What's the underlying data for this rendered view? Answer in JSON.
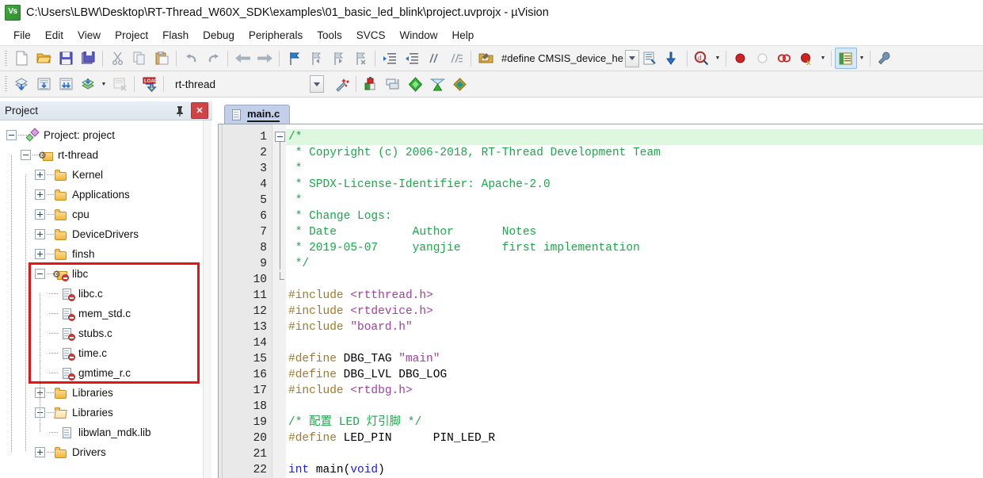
{
  "window": {
    "title": "C:\\Users\\LBW\\Desktop\\RT-Thread_W60X_SDK\\examples\\01_basic_led_blink\\project.uvprojx - µVision",
    "app_icon": "uvision-icon"
  },
  "menubar": {
    "items": [
      "File",
      "Edit",
      "View",
      "Project",
      "Flash",
      "Debug",
      "Peripherals",
      "Tools",
      "SVCS",
      "Window",
      "Help"
    ]
  },
  "toolbar_main": {
    "buttons": [
      {
        "name": "new-file-icon",
        "glyph": "new"
      },
      {
        "name": "open-file-icon",
        "glyph": "open"
      },
      {
        "name": "save-icon",
        "glyph": "save"
      },
      {
        "name": "save-all-icon",
        "glyph": "saveall"
      },
      {
        "name": "cut-icon",
        "glyph": "cut"
      },
      {
        "name": "copy-icon",
        "glyph": "copy"
      },
      {
        "name": "paste-icon",
        "glyph": "paste"
      },
      {
        "name": "undo-icon",
        "glyph": "undo"
      },
      {
        "name": "redo-icon",
        "glyph": "redo"
      },
      {
        "name": "navigate-back-icon",
        "glyph": "back"
      },
      {
        "name": "navigate-forward-icon",
        "glyph": "forward"
      },
      {
        "name": "bookmark-toggle-icon",
        "glyph": "bmk"
      },
      {
        "name": "bookmark-prev-icon",
        "glyph": "bmkprev"
      },
      {
        "name": "bookmark-next-icon",
        "glyph": "bmknext"
      },
      {
        "name": "bookmark-clear-icon",
        "glyph": "bmkclear"
      },
      {
        "name": "indent-icon",
        "glyph": "indent"
      },
      {
        "name": "outdent-icon",
        "glyph": "outdent"
      },
      {
        "name": "comment-icon",
        "glyph": "comment"
      },
      {
        "name": "uncomment-icon",
        "glyph": "uncomment"
      }
    ],
    "define_combo_value": "#define CMSIS_device_he",
    "right_buttons": [
      {
        "name": "configure-target-icon",
        "glyph": "cfgtarget"
      },
      {
        "name": "text-browse-icon",
        "glyph": "browse"
      },
      {
        "name": "insert-code-icon",
        "glyph": "inscode"
      },
      {
        "name": "find-in-files-icon",
        "glyph": "find"
      },
      {
        "name": "breakpoint-icon",
        "glyph": "bp"
      },
      {
        "name": "breakpoint-disable-icon",
        "glyph": "bpoff"
      },
      {
        "name": "kill-breakpoints-icon",
        "glyph": "bpkill"
      },
      {
        "name": "disable-all-breakpoints-icon",
        "glyph": "bpdisall"
      },
      {
        "name": "manage-windows-icon",
        "glyph": "winmgr"
      },
      {
        "name": "configure-icon",
        "glyph": "wrench"
      }
    ]
  },
  "toolbar_build": {
    "buttons": [
      {
        "name": "translate-icon",
        "glyph": "translate"
      },
      {
        "name": "build-icon",
        "glyph": "build"
      },
      {
        "name": "rebuild-icon",
        "glyph": "rebuild"
      },
      {
        "name": "batch-build-icon",
        "glyph": "batch"
      },
      {
        "name": "stop-build-icon",
        "glyph": "stopbuild"
      },
      {
        "name": "download-icon",
        "glyph": "download"
      }
    ],
    "target_value": "rt-thread",
    "right_buttons": [
      {
        "name": "target-options-icon",
        "glyph": "magicwand"
      },
      {
        "name": "manage-project-items-icon",
        "glyph": "projitems"
      },
      {
        "name": "manage-run-time-environment-icon",
        "glyph": "rte"
      },
      {
        "name": "select-software-packs-icon",
        "glyph": "packs"
      },
      {
        "name": "pack-installer-icon",
        "glyph": "packinst"
      },
      {
        "name": "multi-project-icon",
        "glyph": "multiproj"
      }
    ]
  },
  "project_panel": {
    "title": "Project",
    "pin_icon": "pin-icon",
    "close_icon": "close-icon",
    "tree": [
      {
        "label": "Project: project",
        "depth": 0,
        "icon": "proj",
        "state": "expanded",
        "marked": false
      },
      {
        "label": "rt-thread",
        "depth": 1,
        "icon": "group",
        "state": "expanded",
        "marked": false
      },
      {
        "label": "Kernel",
        "depth": 2,
        "icon": "folder",
        "state": "collapsed",
        "marked": false
      },
      {
        "label": "Applications",
        "depth": 2,
        "icon": "folder",
        "state": "collapsed",
        "marked": false
      },
      {
        "label": "cpu",
        "depth": 2,
        "icon": "folder",
        "state": "collapsed",
        "marked": false
      },
      {
        "label": "DeviceDrivers",
        "depth": 2,
        "icon": "folder",
        "state": "collapsed",
        "marked": false
      },
      {
        "label": "finsh",
        "depth": 2,
        "icon": "folder",
        "state": "collapsed",
        "marked": false
      },
      {
        "label": "libc",
        "depth": 2,
        "icon": "group-blocked",
        "state": "expanded",
        "marked": true
      },
      {
        "label": "libc.c",
        "depth": 3,
        "icon": "file-blocked",
        "state": "leaf",
        "marked": true
      },
      {
        "label": "mem_std.c",
        "depth": 3,
        "icon": "file-blocked",
        "state": "leaf",
        "marked": true
      },
      {
        "label": "stubs.c",
        "depth": 3,
        "icon": "file-blocked",
        "state": "leaf",
        "marked": true
      },
      {
        "label": "time.c",
        "depth": 3,
        "icon": "file-blocked",
        "state": "leaf",
        "marked": true
      },
      {
        "label": "gmtime_r.c",
        "depth": 3,
        "icon": "file-blocked",
        "state": "leaf",
        "marked": true
      },
      {
        "label": "Libraries",
        "depth": 2,
        "icon": "folder",
        "state": "collapsed",
        "marked": false
      },
      {
        "label": "Libraries",
        "depth": 2,
        "icon": "folder-open",
        "state": "expanded",
        "marked": false
      },
      {
        "label": "libwlan_mdk.lib",
        "depth": 3,
        "icon": "file",
        "state": "leaf",
        "marked": false
      },
      {
        "label": "Drivers",
        "depth": 2,
        "icon": "folder",
        "state": "collapsed",
        "marked": false
      }
    ],
    "annotation": {
      "name": "red-highlight-box",
      "color": "#ee1111"
    }
  },
  "editor": {
    "tabs": [
      {
        "label": "main.c",
        "active": true,
        "icon": "source-file-icon"
      }
    ],
    "current_line": 1,
    "lines": [
      {
        "n": 1,
        "tokens": [
          {
            "t": "/*",
            "c": "c-comment"
          }
        ],
        "current": true
      },
      {
        "n": 2,
        "tokens": [
          {
            "t": " * Copyright (c) 2006-2018, RT-Thread Development Team",
            "c": "c-comment"
          }
        ]
      },
      {
        "n": 3,
        "tokens": [
          {
            "t": " *",
            "c": "c-comment"
          }
        ]
      },
      {
        "n": 4,
        "tokens": [
          {
            "t": " * SPDX-License-Identifier: Apache-2.0",
            "c": "c-comment"
          }
        ]
      },
      {
        "n": 5,
        "tokens": [
          {
            "t": " *",
            "c": "c-comment"
          }
        ]
      },
      {
        "n": 6,
        "tokens": [
          {
            "t": " * Change Logs:",
            "c": "c-comment"
          }
        ]
      },
      {
        "n": 7,
        "tokens": [
          {
            "t": " * Date           Author       Notes",
            "c": "c-comment"
          }
        ]
      },
      {
        "n": 8,
        "tokens": [
          {
            "t": " * 2019-05-07     yangjie      first implementation",
            "c": "c-comment"
          }
        ]
      },
      {
        "n": 9,
        "tokens": [
          {
            "t": " */",
            "c": "c-comment"
          }
        ]
      },
      {
        "n": 10,
        "tokens": [
          {
            "t": "",
            "c": "c-plain"
          }
        ]
      },
      {
        "n": 11,
        "tokens": [
          {
            "t": "#include ",
            "c": "c-pre"
          },
          {
            "t": "<rtthread.h>",
            "c": "c-str"
          }
        ]
      },
      {
        "n": 12,
        "tokens": [
          {
            "t": "#include ",
            "c": "c-pre"
          },
          {
            "t": "<rtdevice.h>",
            "c": "c-str"
          }
        ]
      },
      {
        "n": 13,
        "tokens": [
          {
            "t": "#include ",
            "c": "c-pre"
          },
          {
            "t": "\"board.h\"",
            "c": "c-str"
          }
        ]
      },
      {
        "n": 14,
        "tokens": [
          {
            "t": "",
            "c": "c-plain"
          }
        ]
      },
      {
        "n": 15,
        "tokens": [
          {
            "t": "#define ",
            "c": "c-pre"
          },
          {
            "t": "DBG_TAG ",
            "c": "c-plain"
          },
          {
            "t": "\"main\"",
            "c": "c-str"
          }
        ]
      },
      {
        "n": 16,
        "tokens": [
          {
            "t": "#define ",
            "c": "c-pre"
          },
          {
            "t": "DBG_LVL DBG_LOG",
            "c": "c-plain"
          }
        ]
      },
      {
        "n": 17,
        "tokens": [
          {
            "t": "#include ",
            "c": "c-pre"
          },
          {
            "t": "<rtdbg.h>",
            "c": "c-str"
          }
        ]
      },
      {
        "n": 18,
        "tokens": [
          {
            "t": "",
            "c": "c-plain"
          }
        ]
      },
      {
        "n": 19,
        "tokens": [
          {
            "t": "/* 配置 LED 灯引脚 */",
            "c": "c-comment"
          }
        ]
      },
      {
        "n": 20,
        "tokens": [
          {
            "t": "#define ",
            "c": "c-pre"
          },
          {
            "t": "LED_PIN      PIN_LED_R",
            "c": "c-plain"
          }
        ]
      },
      {
        "n": 21,
        "tokens": [
          {
            "t": "",
            "c": "c-plain"
          }
        ]
      },
      {
        "n": 22,
        "tokens": [
          {
            "t": "int ",
            "c": "c-kw"
          },
          {
            "t": "main(",
            "c": "c-plain"
          },
          {
            "t": "void",
            "c": "c-kw"
          },
          {
            "t": ")",
            "c": "c-plain"
          }
        ]
      }
    ]
  },
  "colors": {
    "comment": "#1ba84a",
    "preprocessor": "#a07a2a",
    "string": "#a040a0",
    "keyword": "#1a1aff",
    "current_line_bg": "#ddf8df",
    "annotation_red": "#ee1111",
    "tab_active_bg": "#c3cee8"
  }
}
